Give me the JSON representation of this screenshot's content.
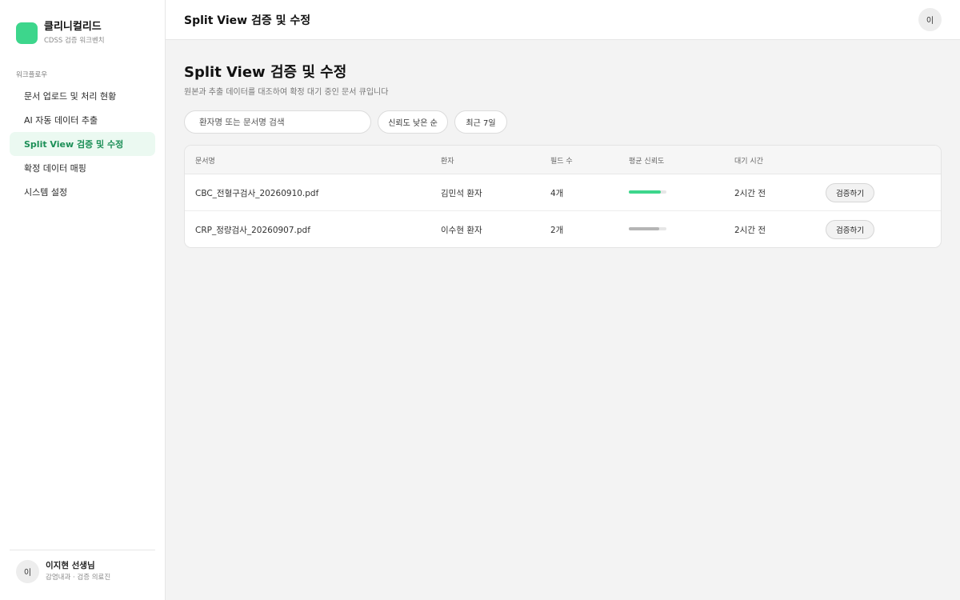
{
  "brand": {
    "name": "클리니컬리드",
    "subtitle": "CDSS 검증 워크벤치"
  },
  "sidebar": {
    "section_label": "워크플로우",
    "items": [
      {
        "label": "문서 업로드 및 처리 현황"
      },
      {
        "label": "AI 자동 데이터 추출"
      },
      {
        "label": "Split View 검증 및 수정"
      },
      {
        "label": "확정 데이터 매핑"
      },
      {
        "label": "시스템 설정"
      }
    ],
    "active_index": 2
  },
  "user": {
    "avatar": "이",
    "name": "이지현 선생님",
    "role": "감염내과 · 검증 의료진"
  },
  "topbar": {
    "title": "Split View 검증 및 수정",
    "avatar": "이"
  },
  "page": {
    "title": "Split View 검증 및 수정",
    "subtitle": "원본과 추출 데이터를 대조하여 확정 대기 중인 문서 큐입니다"
  },
  "filters": {
    "search_placeholder": "환자명 또는 문서명 검색",
    "sort_label": "신뢰도 낮은 순",
    "period_label": "최근 7일"
  },
  "table": {
    "columns": [
      "문서명",
      "환자",
      "필드 수",
      "평균 신뢰도",
      "대기 시간"
    ],
    "rows": [
      {
        "document": "CBC_전혈구검사_20260910.pdf",
        "patient": "김민석 환자",
        "fields": "4개",
        "confidence": 0.85,
        "confidence_color": "#3dd68c",
        "wait": "2시간 전",
        "action": "검증하기"
      },
      {
        "document": "CRP_정량검사_20260907.pdf",
        "patient": "이수현 환자",
        "fields": "2개",
        "confidence": 0.8,
        "confidence_color": "#b5b5b5",
        "wait": "2시간 전",
        "action": "검증하기"
      }
    ]
  },
  "colors": {
    "accent": "#3dd68c",
    "active_nav_bg": "#ebf9f1",
    "active_nav_text": "#1c8f57"
  }
}
